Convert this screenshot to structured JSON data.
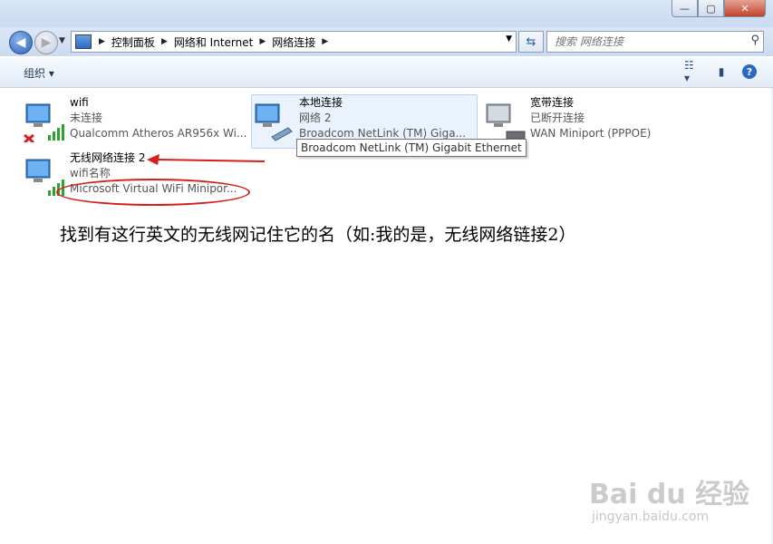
{
  "address": {
    "crumbs": [
      "控制面板",
      "网络和 Internet",
      "网络连接"
    ]
  },
  "search": {
    "placeholder": "搜索 网络连接"
  },
  "toolbar": {
    "organize": "组织 ▾"
  },
  "connections": [
    {
      "name": "wifi",
      "status": "未连接",
      "device": "Qualcomm Atheros AR956x Wi..."
    },
    {
      "name": "本地连接",
      "status": "网络  2",
      "device": "Broadcom NetLink (TM) Giga..."
    },
    {
      "name": "宽带连接",
      "status": "已断开连接",
      "device": "WAN Miniport (PPPOE)"
    },
    {
      "name": "无线网络连接 2",
      "status": "wifi名称",
      "device": "Microsoft Virtual WiFi Minipor..."
    }
  ],
  "tooltip": "Broadcom NetLink (TM) Gigabit Ethernet",
  "annotation": "找到有这行英文的无线网记住它的名（如:我的是，无线网络链接2）",
  "watermark": {
    "brand": "Bai du 经验",
    "url": "jingyan.baidu.com"
  },
  "colors": {
    "annotation_red": "#d61e1e",
    "selected_bg": "#e9f2fd"
  }
}
